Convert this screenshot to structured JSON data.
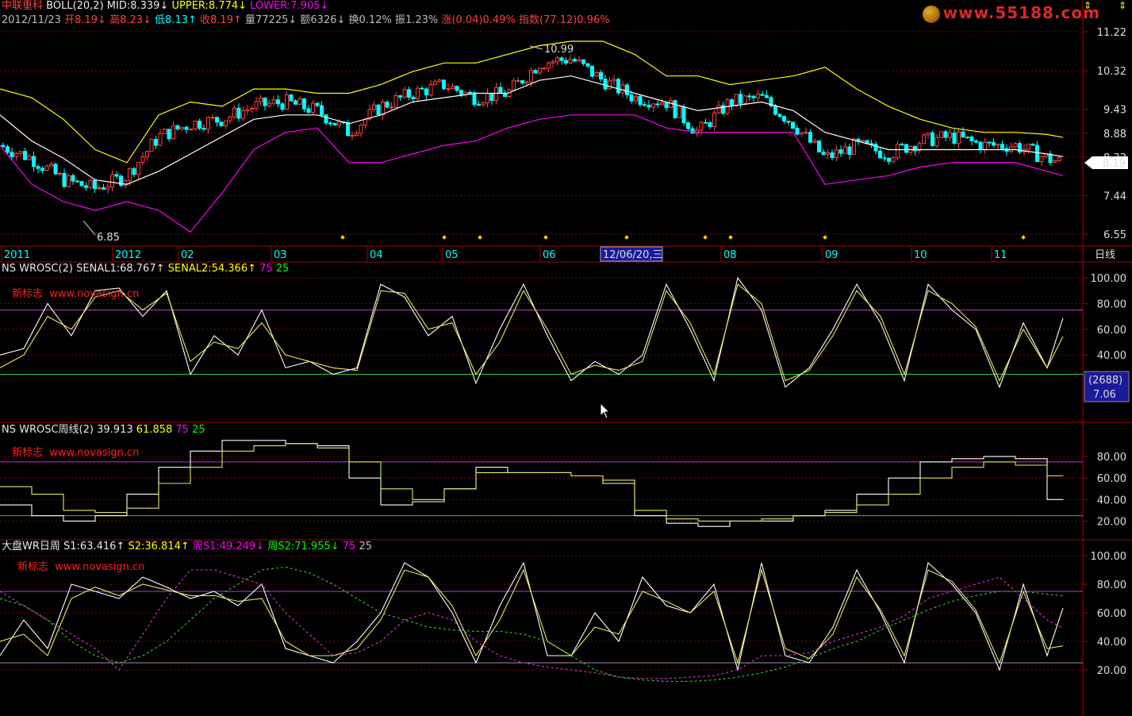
{
  "header": {
    "stock": "中联重科",
    "indicator": "BOLL(20,2)",
    "mid": "MID:8.339↓",
    "upper": "UPPER:8.774↓",
    "lower": "LOWER:7.905↓",
    "row2": {
      "date": "2012/11/23",
      "open": "开8.19↓",
      "high": "高8.23↓",
      "low": "低8.13↑",
      "close": "收8.19↑",
      "volume": "量77225↓",
      "amount": "额6326↓",
      "turnover": "换0.12%",
      "amplitude": "振1.23%",
      "change": "涨(0.04)0.49%",
      "index": "指数(77.12)0.96%"
    }
  },
  "watermark": "www.55188.com",
  "brand_text": "新标志",
  "brand_url": "www.novasign.cn",
  "price_panel": {
    "y_ticks": [
      "11.22",
      "10.32",
      "9.43",
      "8.88",
      "8.33",
      "7.44",
      "6.55"
    ],
    "last_price": "8.19",
    "high_label": "10.99",
    "low_label": "6.85",
    "x_labels": [
      "2011",
      "2012",
      "02",
      "03",
      "04",
      "05",
      "06",
      "08",
      "09",
      "10",
      "11"
    ],
    "cursor_date": "12/06/20,三",
    "period": "日线"
  },
  "panel2": {
    "title": "NS WROSC(2)",
    "senal1": "SENAL1:68.767↑",
    "senal2": "SENAL2:54.366↑",
    "v75": "75",
    "v25": "25",
    "y_ticks": [
      "100.00",
      "80.00",
      "60.00",
      "40.00"
    ],
    "cursor_box1": "(2688)",
    "cursor_box2": "7.06"
  },
  "panel3": {
    "title": "NS WROSC周线(2)",
    "v1": "39.913",
    "v2": "61.858",
    "v75": "75",
    "v25": "25",
    "y_ticks": [
      "80.00",
      "60.00",
      "40.00",
      "20.00"
    ]
  },
  "panel4": {
    "title": "大盘WR日周",
    "s1": "S1:63.416↑",
    "s2": "S2:36.814↑",
    "ws1": "周S1:49.249↓",
    "ws2": "周S2:71.955↓",
    "v75": "75",
    "v25": "25",
    "y_ticks": [
      "100.00",
      "80.00",
      "60.00",
      "40.00",
      "20.00"
    ]
  },
  "chart_data": [
    {
      "type": "line",
      "title": "BOLL(20,2)",
      "x": [
        0,
        40,
        80,
        120,
        160,
        200,
        240,
        280,
        320,
        360,
        400,
        440,
        480,
        520,
        560,
        600,
        640,
        680,
        720,
        760,
        800,
        840,
        880,
        920,
        960,
        1000,
        1040,
        1080,
        1120,
        1160,
        1200,
        1240,
        1280,
        1320,
        1340
      ],
      "series": [
        {
          "name": "UPPER",
          "values": [
            9.9,
            9.7,
            9.2,
            8.5,
            8.2,
            9.3,
            9.6,
            9.5,
            9.9,
            9.9,
            9.8,
            9.8,
            10.0,
            10.3,
            10.5,
            10.5,
            10.7,
            10.9,
            11.0,
            11.0,
            10.7,
            10.2,
            10.2,
            10.0,
            10.1,
            10.2,
            10.4,
            9.9,
            9.5,
            9.2,
            9.0,
            8.9,
            8.9,
            8.85,
            8.78
          ]
        },
        {
          "name": "MID",
          "values": [
            9.3,
            8.7,
            8.3,
            7.8,
            7.7,
            8.0,
            8.4,
            8.8,
            9.2,
            9.3,
            9.3,
            9.1,
            9.3,
            9.6,
            9.7,
            9.8,
            9.8,
            10.1,
            10.2,
            10.0,
            9.8,
            9.6,
            9.4,
            9.5,
            9.6,
            9.4,
            8.9,
            8.7,
            8.5,
            8.5,
            8.5,
            8.5,
            8.5,
            8.4,
            8.34
          ]
        },
        {
          "name": "LOWER",
          "values": [
            8.6,
            7.7,
            7.3,
            7.1,
            7.3,
            7.1,
            6.6,
            7.5,
            8.5,
            8.9,
            9.0,
            8.2,
            8.2,
            8.4,
            8.6,
            8.7,
            9.0,
            9.2,
            9.3,
            9.3,
            9.3,
            9.0,
            8.9,
            8.9,
            8.9,
            8.9,
            7.7,
            7.8,
            7.9,
            8.1,
            8.2,
            8.2,
            8.2,
            8.0,
            7.9
          ]
        }
      ],
      "close": [
        8.6,
        8.3,
        7.8,
        7.6,
        7.9,
        8.8,
        9.1,
        9.2,
        9.5,
        9.6,
        9.4,
        8.9,
        9.5,
        9.8,
        10.0,
        9.7,
        9.8,
        10.5,
        10.6,
        10.1,
        9.7,
        9.6,
        8.9,
        9.6,
        9.7,
        9.1,
        8.3,
        8.6,
        8.4,
        8.7,
        8.8,
        8.6,
        8.6,
        8.3,
        8.19
      ],
      "ylim": [
        6.55,
        11.22
      ],
      "annotations": [
        {
          "label": "10.99"
        },
        {
          "label": "6.85"
        }
      ]
    },
    {
      "type": "line",
      "title": "NS WROSC(2)",
      "x": [
        0,
        30,
        60,
        90,
        120,
        150,
        180,
        210,
        240,
        270,
        300,
        330,
        360,
        390,
        420,
        450,
        480,
        510,
        540,
        570,
        600,
        630,
        660,
        690,
        720,
        750,
        780,
        810,
        840,
        870,
        900,
        930,
        960,
        990,
        1020,
        1050,
        1080,
        1110,
        1140,
        1170,
        1200,
        1230,
        1260,
        1290,
        1320,
        1340
      ],
      "series": [
        {
          "name": "SENAL1",
          "values": [
            40,
            45,
            80,
            55,
            90,
            92,
            70,
            90,
            25,
            55,
            40,
            75,
            30,
            35,
            25,
            30,
            95,
            85,
            55,
            70,
            18,
            60,
            95,
            55,
            20,
            35,
            25,
            40,
            95,
            60,
            20,
            100,
            75,
            15,
            30,
            60,
            95,
            65,
            20,
            95,
            75,
            60,
            15,
            65,
            30,
            68.767
          ]
        },
        {
          "name": "SENAL2",
          "values": [
            30,
            40,
            70,
            60,
            85,
            90,
            75,
            88,
            35,
            50,
            45,
            65,
            40,
            35,
            30,
            28,
            90,
            88,
            60,
            65,
            25,
            50,
            90,
            60,
            25,
            32,
            28,
            35,
            90,
            65,
            25,
            95,
            80,
            20,
            28,
            55,
            90,
            70,
            25,
            90,
            80,
            62,
            20,
            60,
            30,
            54.366
          ]
        }
      ],
      "hlines": [
        75,
        25
      ],
      "ylim": [
        0,
        100
      ]
    },
    {
      "type": "line",
      "title": "NS WROSC周线(2)",
      "x": [
        0,
        40,
        80,
        120,
        160,
        200,
        240,
        280,
        320,
        360,
        400,
        440,
        480,
        520,
        560,
        600,
        640,
        680,
        720,
        760,
        800,
        840,
        880,
        920,
        960,
        1000,
        1040,
        1080,
        1120,
        1160,
        1200,
        1240,
        1280,
        1320,
        1340
      ],
      "series": [
        {
          "name": "S1",
          "values": [
            35,
            25,
            20,
            25,
            45,
            70,
            85,
            95,
            95,
            92,
            90,
            60,
            35,
            38,
            50,
            70,
            65,
            65,
            62,
            55,
            25,
            18,
            15,
            20,
            20,
            25,
            30,
            45,
            60,
            75,
            78,
            80,
            78,
            40,
            39.913
          ]
        },
        {
          "name": "S2",
          "values": [
            52,
            45,
            30,
            28,
            32,
            55,
            70,
            85,
            90,
            92,
            88,
            75,
            50,
            40,
            50,
            65,
            65,
            65,
            62,
            58,
            30,
            22,
            20,
            20,
            22,
            25,
            28,
            35,
            45,
            60,
            70,
            75,
            72,
            62,
            61.858
          ]
        }
      ],
      "hlines": [
        75,
        25
      ],
      "ylim": [
        10,
        100
      ]
    },
    {
      "type": "line",
      "title": "大盘WR日周",
      "x": [
        0,
        30,
        60,
        90,
        120,
        150,
        180,
        210,
        240,
        270,
        300,
        330,
        360,
        390,
        420,
        450,
        480,
        510,
        540,
        570,
        600,
        630,
        660,
        690,
        720,
        750,
        780,
        810,
        840,
        870,
        900,
        930,
        960,
        990,
        1020,
        1050,
        1080,
        1110,
        1140,
        1170,
        1200,
        1230,
        1260,
        1290,
        1320,
        1340
      ],
      "series": [
        {
          "name": "S1",
          "values": [
            30,
            55,
            35,
            80,
            75,
            70,
            85,
            78,
            70,
            75,
            65,
            80,
            35,
            30,
            25,
            40,
            60,
            95,
            85,
            60,
            25,
            65,
            95,
            30,
            30,
            60,
            40,
            85,
            65,
            60,
            80,
            20,
            95,
            30,
            25,
            50,
            90,
            60,
            25,
            95,
            80,
            60,
            20,
            80,
            30,
            63.416
          ]
        },
        {
          "name": "S2",
          "values": [
            40,
            45,
            30,
            70,
            78,
            72,
            80,
            76,
            72,
            72,
            68,
            70,
            40,
            30,
            30,
            35,
            55,
            90,
            85,
            65,
            30,
            55,
            90,
            40,
            30,
            50,
            45,
            75,
            68,
            60,
            75,
            25,
            90,
            35,
            28,
            45,
            85,
            62,
            30,
            90,
            82,
            62,
            25,
            75,
            35,
            36.814
          ]
        },
        {
          "name": "周S1",
          "values": [
            75,
            65,
            55,
            45,
            35,
            20,
            45,
            70,
            90,
            90,
            85,
            80,
            60,
            45,
            30,
            32,
            40,
            55,
            60,
            55,
            40,
            30,
            25,
            22,
            20,
            18,
            15,
            14,
            14,
            15,
            16,
            20,
            30,
            30,
            32,
            40,
            45,
            50,
            58,
            70,
            75,
            80,
            85,
            70,
            55,
            49.249
          ]
        },
        {
          "name": "周S2",
          "values": [
            70,
            65,
            55,
            40,
            30,
            25,
            30,
            40,
            55,
            70,
            80,
            90,
            92,
            88,
            80,
            70,
            60,
            55,
            50,
            48,
            47,
            47,
            45,
            40,
            30,
            20,
            15,
            13,
            12,
            12,
            13,
            15,
            18,
            22,
            28,
            35,
            40,
            48,
            55,
            62,
            68,
            72,
            75,
            75,
            73,
            71.955
          ]
        }
      ],
      "hlines": [
        75,
        25
      ],
      "ylim": [
        0,
        100
      ]
    }
  ],
  "colors": {
    "up": "#ff4040",
    "down": "#00ffff",
    "mid": "#ffffff",
    "upper": "#ffff00",
    "lower": "#ff00ff",
    "green": "#00ff00",
    "grid": "#8b0000"
  }
}
